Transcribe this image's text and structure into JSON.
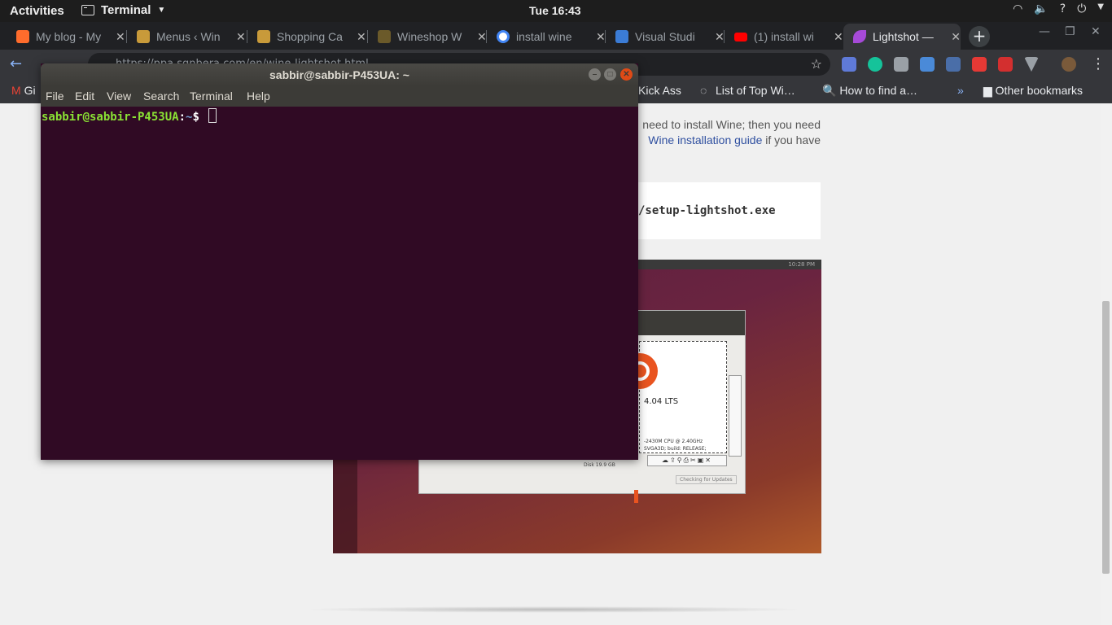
{
  "topbar": {
    "activities": "Activities",
    "app_name": "Terminal",
    "clock": "Tue 16:43",
    "tray": [
      "wifi-icon",
      "volume-icon",
      "help-icon",
      "power-icon"
    ]
  },
  "browser": {
    "tabs": [
      {
        "title": "My blog - My",
        "color": "#ff6c2c"
      },
      {
        "title": "Menus ‹ Win",
        "color": "#c89a3a"
      },
      {
        "title": "Shopping Ca",
        "color": "#c89a3a"
      },
      {
        "title": "Wineshop W",
        "color": "#6b5a2a"
      },
      {
        "title": "install wine",
        "color": "#4285f4"
      },
      {
        "title": "Visual Studi",
        "color": "#3b7cd6"
      },
      {
        "title": "(1) install wi",
        "color": "#ff0000"
      },
      {
        "title": "Lightshot —",
        "color": "#a64ad8",
        "active": true
      }
    ],
    "url": "https://ppa.sgnbera.com/en/wine-lightshot.html",
    "bookmarks": {
      "gmail": "Gi",
      "kick_ass": "Kick Ass",
      "list_top": "List of Top Wi…",
      "how_to": "How to find a…",
      "more": "»",
      "other": "Other bookmarks"
    }
  },
  "webpage": {
    "line1": "need to install Wine; then you need",
    "line2_link": "Wine installation guide",
    "line2_rest": " if you have",
    "code": "/setup-lightshot.exe",
    "shot": {
      "lts": "4.04 LTS",
      "cpu": "-2430M CPU @ 2.40GHz",
      "gpu": "SVGA3D; build: RELEASE;",
      "disk": "Disk    19.9 GB",
      "updates": "Checking for Updates",
      "clock": "10:28 PM"
    }
  },
  "terminal": {
    "title": "sabbir@sabbir-P453UA: ~",
    "menu": [
      "File",
      "Edit",
      "View",
      "Search",
      "Terminal",
      "Help"
    ],
    "prompt_user": "sabbir@sabbir-P453UA",
    "prompt_sep": ":",
    "prompt_path": "~",
    "prompt_dollar": "$ "
  }
}
